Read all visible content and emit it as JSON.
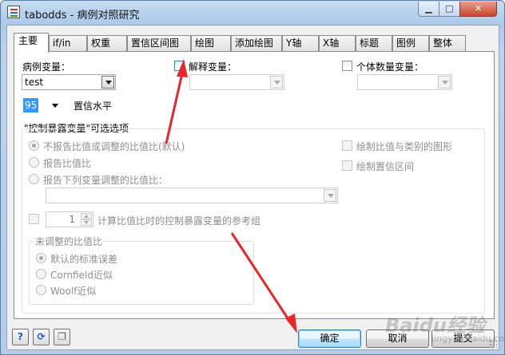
{
  "window": {
    "title": "tabodds - 病例对照研究"
  },
  "tabs": [
    {
      "label": "主要"
    },
    {
      "label": "if/in"
    },
    {
      "label": "权重"
    },
    {
      "label": "置信区间图"
    },
    {
      "label": "绘图"
    },
    {
      "label": "添加绘图"
    },
    {
      "label": "Y轴"
    },
    {
      "label": "X轴"
    },
    {
      "label": "标题"
    },
    {
      "label": "图例"
    },
    {
      "label": "整体"
    }
  ],
  "main": {
    "case_var_label": "病例变量：",
    "case_var_value": "test",
    "explanatory_var_label": "解释变量：",
    "explanatory_var_value": "",
    "count_var_label": "个体数量变量：",
    "count_var_value": "",
    "conf_level_value": "95",
    "conf_level_label": "置信水平",
    "options_group_title": "\"控制暴露变量\"可选选项",
    "radio_no_report": "不报告比值或调整的比值比(默认)",
    "radio_report_or": "报告比值比",
    "radio_report_adjusted": "报告下列变量调整的比值比：",
    "adjust_vars_value": "",
    "ref_group_value": "1",
    "ref_group_label": "计算比值比时的控制暴露变量的参考组",
    "chk_graph_or": "绘制比值与类别的图形",
    "chk_graph_ci": "绘制置信区间",
    "unadjusted_group_title": "未调整的比值比",
    "radio_default_se": "默认的标准误差",
    "radio_cornfield": "Cornfield近似",
    "radio_woolf": "Woolf近似"
  },
  "buttons": {
    "ok": "确定",
    "cancel": "取消",
    "submit": "提交"
  },
  "watermark": {
    "text": "Baidu经验",
    "sub": "jingyan.baidu.com"
  },
  "colors": {
    "annotation_arrow": "#e8272b",
    "selection": "#3399ff"
  }
}
